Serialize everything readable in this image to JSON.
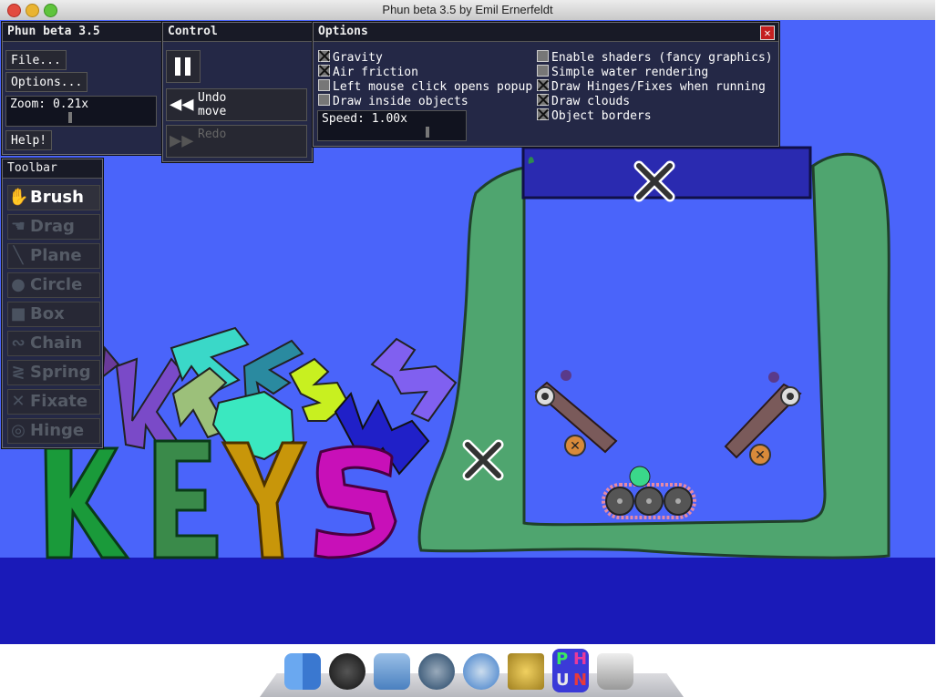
{
  "window": {
    "title": "Phun beta 3.5 by Emil Ernerfeldt"
  },
  "main_panel": {
    "title": "Phun beta 3.5",
    "file_button": "File...",
    "options_button": "Options...",
    "zoom_label": "Zoom: 0.21x",
    "help_button": "Help!"
  },
  "control_panel": {
    "title": "Control",
    "undo_label_1": "Undo",
    "undo_label_2": "move",
    "redo_label": "Redo"
  },
  "options_panel": {
    "title": "Options",
    "speed_label": "Speed: 1.00x",
    "left_options": [
      {
        "label": "Gravity",
        "checked": true
      },
      {
        "label": "Air friction",
        "checked": true
      },
      {
        "label": "Left mouse click opens popup",
        "checked": false
      },
      {
        "label": "Draw inside objects",
        "checked": false
      }
    ],
    "right_options": [
      {
        "label": "Enable shaders (fancy graphics)",
        "checked": false
      },
      {
        "label": "Simple water rendering",
        "checked": false
      },
      {
        "label": "Draw Hinges/Fixes when running",
        "checked": true
      },
      {
        "label": "Draw clouds",
        "checked": true
      },
      {
        "label": "Object borders",
        "checked": true
      }
    ]
  },
  "toolbar": {
    "title": "Toolbar",
    "tools": [
      {
        "label": "Brush",
        "icon": "brush-icon",
        "active": true
      },
      {
        "label": "Drag",
        "icon": "drag-hand-icon",
        "active": false
      },
      {
        "label": "Plane",
        "icon": "plane-icon",
        "active": false
      },
      {
        "label": "Circle",
        "icon": "circle-icon",
        "active": false
      },
      {
        "label": "Box",
        "icon": "box-icon",
        "active": false
      },
      {
        "label": "Chain",
        "icon": "chain-icon",
        "active": false
      },
      {
        "label": "Spring",
        "icon": "spring-icon",
        "active": false
      },
      {
        "label": "Fixate",
        "icon": "fixate-icon",
        "active": false
      },
      {
        "label": "Hinge",
        "icon": "hinge-icon",
        "active": false
      }
    ]
  },
  "scene": {
    "letters": [
      "K",
      "E",
      "Y",
      "S"
    ],
    "colors": {
      "sky": "#4a64fa",
      "ground": "#1a1ab8",
      "container": "#4fa56f"
    }
  },
  "dock": {
    "items": [
      "finder-icon",
      "dashboard-icon",
      "mail-icon",
      "time-machine-icon",
      "safari-icon",
      "imovie-icon",
      "phun-icon",
      "trash-icon"
    ],
    "phun_letters": [
      "P",
      "H",
      "U",
      "N"
    ]
  }
}
